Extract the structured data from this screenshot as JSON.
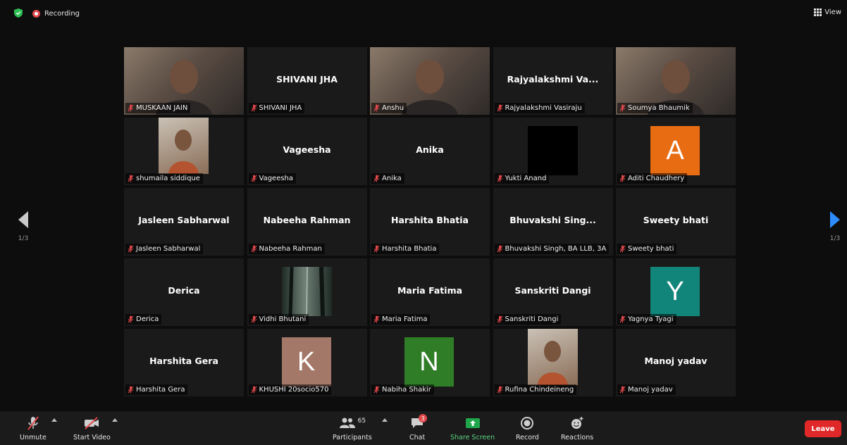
{
  "topbar": {
    "recording_label": "Recording",
    "view_label": "View"
  },
  "pager": {
    "left_page": "1/3",
    "right_page": "1/3"
  },
  "tiles": [
    {
      "display_name": "",
      "label": "MUSKAAN JAIN",
      "media": "video"
    },
    {
      "display_name": "SHIVANI JHA",
      "label": "SHIVANI JHA",
      "media": "none"
    },
    {
      "display_name": "",
      "label": "Anshu",
      "media": "video",
      "active": true
    },
    {
      "display_name": "Rajyalakshmi  Va...",
      "label": "Rajyalakshmi Vasiraju",
      "media": "none"
    },
    {
      "display_name": "",
      "label": "Soumya Bhaumik",
      "media": "video"
    },
    {
      "display_name": "",
      "label": "shumaila siddique",
      "media": "small-video"
    },
    {
      "display_name": "Vageesha",
      "label": "Vageesha",
      "media": "none"
    },
    {
      "display_name": "Anika",
      "label": "Anika",
      "media": "none"
    },
    {
      "display_name": "",
      "label": "Yukti Anand",
      "media": "black"
    },
    {
      "display_name": "",
      "label": "Aditi Chaudhery",
      "media": "letter",
      "letter": "A",
      "color": "#e86c12"
    },
    {
      "display_name": "Jasleen Sabharwal",
      "label": "Jasleen Sabharwal",
      "media": "none"
    },
    {
      "display_name": "Nabeeha Rahman",
      "label": "Nabeeha Rahman",
      "media": "none"
    },
    {
      "display_name": "Harshita Bhatia",
      "label": "Harshita Bhatia",
      "media": "none"
    },
    {
      "display_name": "Bhuvakshi  Sing...",
      "label": "Bhuvakshi Singh, BA LLB, 3A",
      "media": "none"
    },
    {
      "display_name": "Sweety bhati",
      "label": "Sweety bhati",
      "media": "none"
    },
    {
      "display_name": "Derica",
      "label": "Derica",
      "media": "none"
    },
    {
      "display_name": "",
      "label": "Vidhi Bhutani",
      "media": "forest"
    },
    {
      "display_name": "Maria Fatima",
      "label": "Maria Fatima",
      "media": "none"
    },
    {
      "display_name": "Sanskriti Dangi",
      "label": "Sanskriti Dangi",
      "media": "none"
    },
    {
      "display_name": "",
      "label": "Yagnya Tyagi",
      "media": "letter",
      "letter": "Y",
      "color": "#12857a"
    },
    {
      "display_name": "Harshita Gera",
      "label": "Harshita Gera",
      "media": "none"
    },
    {
      "display_name": "",
      "label": "KHUSHI 20socio570",
      "media": "letter",
      "letter": "K",
      "color": "#a37868"
    },
    {
      "display_name": "",
      "label": "Nabiha Shakir",
      "media": "letter",
      "letter": "N",
      "color": "#2f7d27"
    },
    {
      "display_name": "",
      "label": "Rufina Chindeineng",
      "media": "small-video"
    },
    {
      "display_name": "Manoj yadav",
      "label": "Manoj yadav",
      "media": "none"
    }
  ],
  "toolbar": {
    "unmute": "Unmute",
    "start_video": "Start Video",
    "participants": "Participants",
    "participants_count": "65",
    "chat": "Chat",
    "chat_badge": "3",
    "share_screen": "Share Screen",
    "record": "Record",
    "reactions": "Reactions",
    "leave": "Leave"
  },
  "colors": {
    "active_border": "#c2e35b",
    "share_green": "#5ad17f",
    "leave_red": "#e02828",
    "next_arrow": "#2d8cff"
  }
}
